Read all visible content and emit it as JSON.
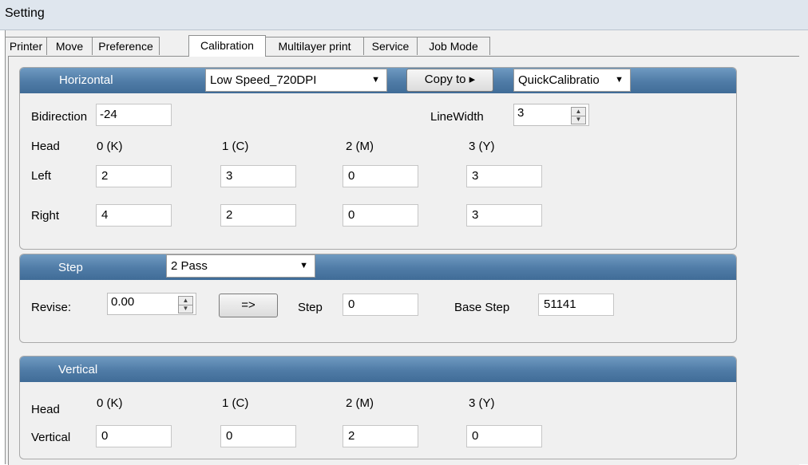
{
  "window": {
    "title": "Setting"
  },
  "tabs": [
    "Printer",
    "Move",
    "Preference",
    "Calibration",
    "Multilayer print",
    "Service",
    "Job Mode"
  ],
  "active_tab": "Calibration",
  "horizontal": {
    "title": "Horizontal",
    "speed": "Low Speed_720DPI",
    "copy_to": "Copy to ▸",
    "quick": "QuickCalibratio",
    "bidirection_label": "Bidirection",
    "bidirection_value": "-24",
    "linewidth_label": "LineWidth",
    "linewidth_value": "3",
    "head_label": "Head",
    "heads": [
      "0 (K)",
      "1 (C)",
      "2 (M)",
      "3 (Y)"
    ],
    "left_label": "Left",
    "left_values": [
      "2",
      "3",
      "0",
      "3"
    ],
    "right_label": "Right",
    "right_values": [
      "4",
      "2",
      "0",
      "3"
    ]
  },
  "step": {
    "title": "Step",
    "pass": "2 Pass",
    "revise_label": "Revise:",
    "revise_value": "0.00",
    "apply_button": "=>",
    "step_label": "Step",
    "step_value": "0",
    "base_step_label": "Base Step",
    "base_step_value": "51141"
  },
  "vertical": {
    "title": "Vertical",
    "head_label": "Head",
    "heads": [
      "0 (K)",
      "1 (C)",
      "2 (M)",
      "3 (Y)"
    ],
    "vertical_label": "Vertical",
    "values": [
      "0",
      "0",
      "2",
      "0"
    ]
  }
}
